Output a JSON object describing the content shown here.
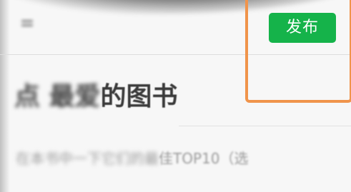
{
  "header": {
    "menu_icon": "menu-icon",
    "publish_label": "发布"
  },
  "article": {
    "title_blurred": "点 最爱",
    "title_visible": "的图书",
    "subtitle_blurred": "在本书中一下它们的最",
    "subtitle_visible": "佳TOP10（选"
  },
  "colors": {
    "publish_button": "#15b34a",
    "highlight_border": "#f0944b",
    "background": "#f7f7f7"
  }
}
